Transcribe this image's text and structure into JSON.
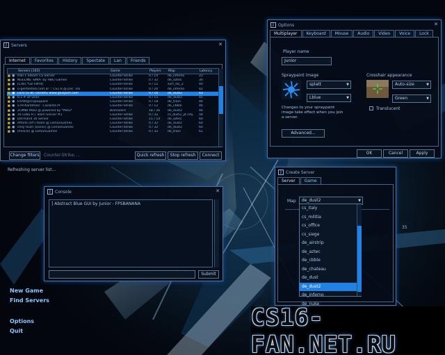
{
  "menu": {
    "new_game": "New Game",
    "find_servers": "Find Servers",
    "options": "Options",
    "quit": "Quit"
  },
  "watermark": {
    "text": "CS16-FAN.NET.RU"
  },
  "servers": {
    "icon_letter": "J",
    "title": "Servers",
    "tabs": [
      "Internet",
      "Favorites",
      "History",
      "Spectate",
      "Lan",
      "Friends"
    ],
    "columns": {
      "name": "Servers (103)",
      "game": "Game",
      "players": "Players",
      "map": "Map",
      "latency": "Latency"
    },
    "rows": [
      {
        "name": "Hall 1 Steam CS Server",
        "game": "Counter-Strike",
        "players": "0 / 14",
        "map": "de_inferno",
        "latency": "22"
      },
      {
        "name": "NGELINE -BMA- by HBG Games",
        "game": "Counter-Strike",
        "players": "0 / 32",
        "map": "de_aztec",
        "latency": "30"
      },
      {
        "name": "[Cde] *LB F8frd]",
        "game": "Counter-Strike",
        "players": "0 / 12",
        "map": "surf_ski_2",
        "latency": "40"
      },
      {
        "name": "o-gentested.com.ar :: CS1.6 @ pac. nlo",
        "game": "Counter-Strike",
        "players": "0 / 20",
        "map": "de_inferno",
        "latency": "42"
      },
      {
        "name": "Lord LS-BC-DarkRG www.gaisport.com",
        "game": "Counter-Strike",
        "players": "0 / 16",
        "map": "de_dust2",
        "latency": "43"
      },
      {
        "name": "6:z # Of Dran",
        "game": "Counter-Strike",
        "players": "0 / 15",
        "map": "de_dust2",
        "latency": "45"
      },
      {
        "name": "FinAtt@rcopSquare",
        "game": "Counter-Strike",
        "players": "0 / 18",
        "map": "de_train",
        "latency": "46"
      },
      {
        "name": "STR-Kantiteaz - Cananta Pr",
        "game": "Counter-Strike",
        "players": "0 / 12",
        "map": "de_cbble",
        "latency": "46"
      },
      {
        "name": "ZOMBI MOD @ powered by *Miku*",
        "game": "Biohazard",
        "players": "18 / 26",
        "map": "de_dust2",
        "latency": "46"
      },
      {
        "name": "16 Lobo H | Team Server #1",
        "game": "Counter-Strike",
        "players": "0 / 32",
        "map": "cs_dust2_yt.city",
        "latency": "56"
      },
      {
        "name": "Ekt-Hand 16 Server",
        "game": "Counter-Strike",
        "players": "11 / 14",
        "map": "de_aztec",
        "latency": "60"
      },
      {
        "name": "efforts [ef!] team @ LemonGames",
        "game": "Counter-Strike",
        "players": "0 / 32",
        "map": "de_dust2",
        "latency": "60"
      },
      {
        "name": "Only Rush [zones] @ LemonGames",
        "game": "Counter-Strike",
        "players": "0 / 32",
        "map": "de_dust2",
        "latency": "60"
      },
      {
        "name": "[PinoTe] @ LemonGames",
        "game": "Counter-Strike",
        "players": "0 / 32",
        "map": "de_train",
        "latency": "61"
      }
    ],
    "selected_index": 4,
    "scroll_position": 0.35,
    "change_filters": "Change filters",
    "filter_text": "Counter-Strike; ...",
    "quick_refresh": "Quick refresh",
    "stop_refresh": "Stop refresh",
    "connect": "Connect",
    "status": "Refreshing server list..."
  },
  "options": {
    "icon_letter": "J",
    "title": "Options",
    "tabs": [
      "Multiplayer",
      "Keyboard",
      "Mouse",
      "Audio",
      "Video",
      "Voice",
      "Lock"
    ],
    "player_name_label": "Player name",
    "player_name": "Junior",
    "spraypaint_label": "Spraypaint image",
    "spray_value": "splatt",
    "spray_color": "Lblue",
    "spray_note": "Changes to your spraypaint image take effect when you join a server.",
    "crosshair_label": "Crosshair appearance",
    "crosshair_size": "Auto-size",
    "crosshair_color": "Green",
    "translucent_label": "Translucent",
    "advanced": "Advanced...",
    "ok": "OK",
    "cancel": "Cancel",
    "apply": "Apply"
  },
  "console": {
    "icon_letter": "J",
    "title": "Console",
    "text": "] Abstract Blue GUI by Junior - FPSBANANA",
    "input": "",
    "submit": "Submit"
  },
  "create_server": {
    "icon_letter": "J",
    "title": "Create Server",
    "tabs": [
      "Server",
      "Game"
    ],
    "map_label": "Map",
    "map_value": "de_dust2",
    "map_options": [
      "cs_italy",
      "cs_militia",
      "cs_office",
      "cs_siege",
      "de_airstrip",
      "de_aztec",
      "de_cbble",
      "de_chateau",
      "de_dust",
      "de_dust2",
      "de_inferno",
      "de_nuke"
    ],
    "selected_map_index": 9,
    "scroll_position": 0.85,
    "side_text": "35"
  },
  "colors": {
    "accent": "#1f82e6",
    "text": "#a9cce8",
    "border": "#5d6f88"
  }
}
